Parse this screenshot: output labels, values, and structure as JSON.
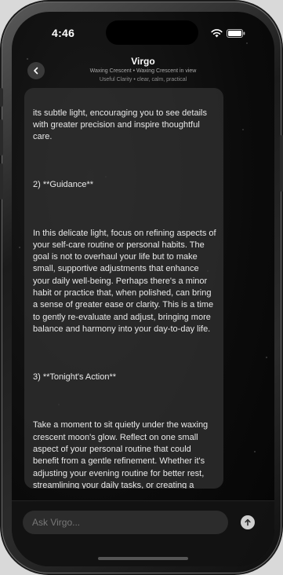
{
  "status_bar": {
    "time": "4:46",
    "wifi_icon": "wifi-icon",
    "battery_icon": "battery-icon"
  },
  "header": {
    "back_icon": "chevron-left-icon",
    "title": "Virgo",
    "subtitle": "Waxing Crescent • Waxing Crescent in view",
    "tagline": "Useful Clarity • clear, calm, practical"
  },
  "message": {
    "paragraphs": [
      "its subtle light, encouraging you to see details with greater precision and inspire thoughtful care.",
      "2) **Guidance**",
      "In this delicate light, focus on refining aspects of your self-care routine or personal habits. The goal is not to overhaul your life but to make small, supportive adjustments that enhance your daily well-being. Perhaps there's a minor habit or practice that, when polished, can bring a sense of greater ease or clarity. This is a time to gently re-evaluate and adjust, bringing more balance and harmony into your day-to-day life.",
      "3) **Tonight's Action**",
      "Take a moment to sit quietly under the waxing crescent moon's glow. Reflect on one small aspect of your personal routine that could benefit from a gentle refinement. Whether it's adjusting your evening routine for better rest, streamlining your daily tasks, or creating a moment of stillness in your day, let this lunar phase guide you toward practical and nurturing adjustments. Remember, the aim is gentle progress, not perfection."
    ]
  },
  "input": {
    "placeholder": "Ask Virgo...",
    "value": "",
    "send_icon": "arrow-up-icon"
  },
  "colors": {
    "background": "#0b0b0b",
    "bubble": "#303030",
    "text": "#e9e9e9",
    "muted": "#a9a9a9"
  }
}
